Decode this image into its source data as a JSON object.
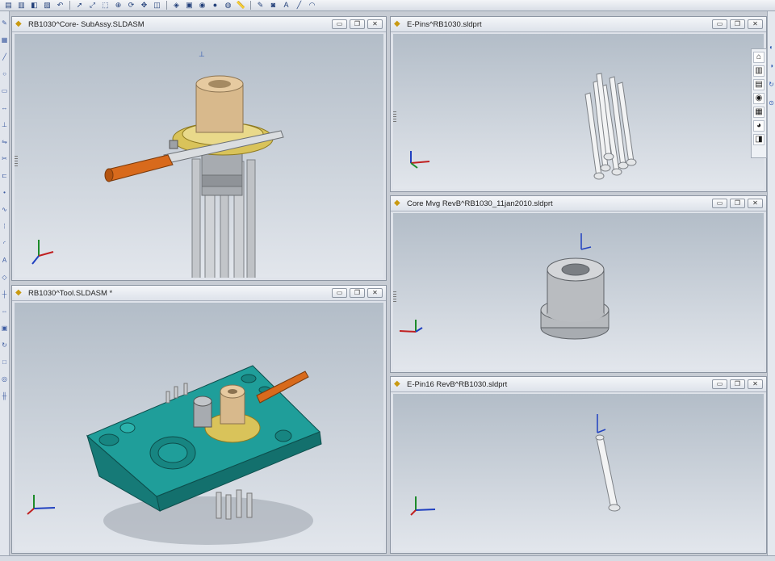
{
  "windows": [
    {
      "title": "RB1030^Core- SubAssy.SLDASM"
    },
    {
      "title": "RB1030^Tool.SLDASM *"
    },
    {
      "title": "E-Pins^RB1030.sldprt"
    },
    {
      "title": "Core Mvg RevB^RB1030_11jan2010.sldprt"
    },
    {
      "title": "E-Pin16 RevB^RB1030.sldprt"
    }
  ],
  "window_controls": {
    "minimize": "▭",
    "restore": "❐",
    "close": "✕"
  },
  "colors": {
    "viewport_top": "#b3bdc8",
    "viewport_bottom": "#e2e6ec",
    "plate": "#1f9e9a",
    "brass": "#d9c35a",
    "orange_part": "#d86a1c",
    "steel": "#c9ccd0",
    "bushing": "#d8b98c"
  },
  "icons": {
    "toolbar": [
      "new",
      "open",
      "save",
      "print",
      "undo",
      "select",
      "zoom-fit",
      "zoom-area",
      "zoom-in",
      "rotate",
      "pan",
      "section",
      "view-orientation",
      "display-style",
      "hide-show",
      "appearance",
      "scene",
      "measure",
      "sketch",
      "camera",
      "text",
      "line",
      "arc"
    ],
    "task_pane": [
      "home-icon",
      "resources-icon",
      "design-library-icon",
      "file-explorer-icon",
      "view-palette-icon",
      "appearances-icon",
      "custom-properties-icon"
    ]
  }
}
